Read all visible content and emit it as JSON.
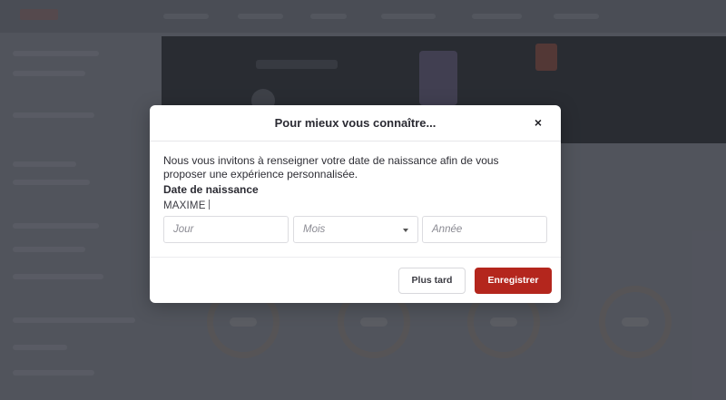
{
  "modal": {
    "title": "Pour mieux vous connaître...",
    "close_symbol": "×",
    "intro_text": "Nous vous invitons à renseigner votre date de naissance afin de vous proposer une expérience personnalisée.",
    "field_label": "Date de naissance",
    "user_name": "MAXIME",
    "inputs": {
      "day_placeholder": "Jour",
      "month_value": "Mois",
      "year_placeholder": "Année"
    },
    "buttons": {
      "later_label": "Plus tard",
      "save_label": "Enregistrer"
    }
  },
  "colors": {
    "primary": "#b4261d",
    "overlay": "#5b5e67"
  },
  "icons": {
    "close": "close-icon",
    "dropdown": "chevron-down-icon"
  }
}
